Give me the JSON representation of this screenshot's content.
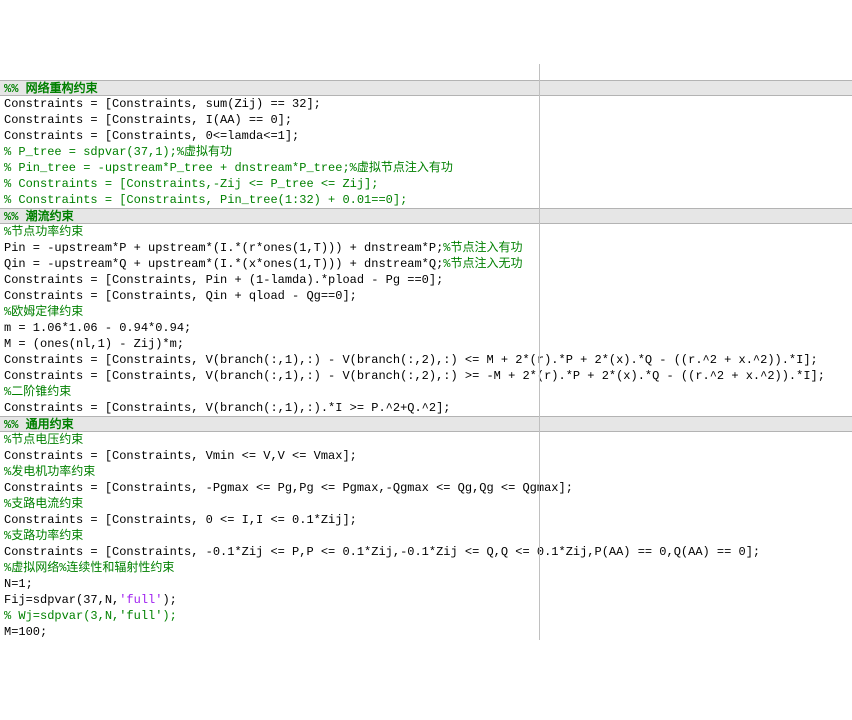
{
  "guides": [
    539
  ],
  "lines": [
    {
      "type": "section",
      "tokens": [
        {
          "cls": "c-section",
          "t": "%% 网络重构约束"
        }
      ]
    },
    {
      "type": "code",
      "tokens": [
        {
          "cls": "c-code",
          "t": "Constraints = [Constraints, sum(Zij) == 32];"
        }
      ]
    },
    {
      "type": "code",
      "tokens": [
        {
          "cls": "c-code",
          "t": "Constraints = [Constraints, I(AA) == 0];"
        }
      ]
    },
    {
      "type": "code",
      "tokens": [
        {
          "cls": "c-code",
          "t": "Constraints = [Constraints, 0<=lamda<=1];"
        }
      ]
    },
    {
      "type": "code",
      "tokens": [
        {
          "cls": "c-comment",
          "t": "% P_tree = sdpvar(37,1);%虚拟有功"
        }
      ]
    },
    {
      "type": "code",
      "tokens": [
        {
          "cls": "c-comment",
          "t": "% Pin_tree = -upstream*P_tree + dnstream*P_tree;%虚拟节点注入有功"
        }
      ]
    },
    {
      "type": "code",
      "tokens": [
        {
          "cls": "c-comment",
          "t": "% Constraints = [Constraints,-Zij <= P_tree <= Zij];"
        }
      ]
    },
    {
      "type": "code",
      "tokens": [
        {
          "cls": "c-comment",
          "t": "% Constraints = [Constraints, Pin_tree(1:32) + 0.01==0];"
        }
      ]
    },
    {
      "type": "section",
      "tokens": [
        {
          "cls": "c-section",
          "t": "%% 潮流约束"
        }
      ]
    },
    {
      "type": "code",
      "tokens": [
        {
          "cls": "c-comment",
          "t": "%节点功率约束"
        }
      ]
    },
    {
      "type": "code",
      "tokens": [
        {
          "cls": "c-code",
          "t": "Pin = -upstream*P + upstream*(I.*(r*ones(1,T))) + dnstream*P;"
        },
        {
          "cls": "c-comment",
          "t": "%节点注入有功"
        }
      ]
    },
    {
      "type": "code",
      "tokens": [
        {
          "cls": "c-code",
          "t": "Qin = -upstream*Q + upstream*(I.*(x*ones(1,T))) + dnstream*Q;"
        },
        {
          "cls": "c-comment",
          "t": "%节点注入无功"
        }
      ]
    },
    {
      "type": "code",
      "tokens": [
        {
          "cls": "c-code",
          "t": "Constraints = [Constraints, Pin + (1-lamda).*pload - Pg ==0];"
        }
      ]
    },
    {
      "type": "code",
      "tokens": [
        {
          "cls": "c-code",
          "t": "Constraints = [Constraints, Qin + qload - Qg==0];"
        }
      ]
    },
    {
      "type": "code",
      "tokens": [
        {
          "cls": "c-comment",
          "t": "%欧姆定律约束"
        }
      ]
    },
    {
      "type": "code",
      "tokens": [
        {
          "cls": "c-code",
          "t": "m = 1.06*1.06 - 0.94*0.94;"
        }
      ]
    },
    {
      "type": "code",
      "tokens": [
        {
          "cls": "c-code",
          "t": "M = (ones(nl,1) - Zij)*m;"
        }
      ]
    },
    {
      "type": "code",
      "tokens": [
        {
          "cls": "c-code",
          "t": "Constraints = [Constraints, V(branch(:,1),:) - V(branch(:,2),:) <= M + 2*(r).*P + 2*(x).*Q - ((r.^2 + x.^2)).*I];"
        }
      ]
    },
    {
      "type": "code",
      "tokens": [
        {
          "cls": "c-code",
          "t": "Constraints = [Constraints, V(branch(:,1),:) - V(branch(:,2),:) >= -M + 2*(r).*P + 2*(x).*Q - ((r.^2 + x.^2)).*I];"
        }
      ]
    },
    {
      "type": "code",
      "tokens": [
        {
          "cls": "c-comment",
          "t": "%二阶锥约束"
        }
      ]
    },
    {
      "type": "code",
      "tokens": [
        {
          "cls": "c-code",
          "t": "Constraints = [Constraints, V(branch(:,1),:).*I >= P.^2+Q.^2];"
        }
      ]
    },
    {
      "type": "section",
      "tokens": [
        {
          "cls": "c-section",
          "t": "%% 通用约束"
        }
      ]
    },
    {
      "type": "code",
      "tokens": [
        {
          "cls": "c-comment",
          "t": "%节点电压约束"
        }
      ]
    },
    {
      "type": "code",
      "tokens": [
        {
          "cls": "c-code",
          "t": "Constraints = [Constraints, Vmin <= V,V <= Vmax];"
        }
      ]
    },
    {
      "type": "code",
      "tokens": [
        {
          "cls": "c-comment",
          "t": "%发电机功率约束"
        }
      ]
    },
    {
      "type": "code",
      "tokens": [
        {
          "cls": "c-code",
          "t": "Constraints = [Constraints, -Pgmax <= Pg,Pg <= Pgmax,-Qgmax <= Qg,Qg <= Qgmax];"
        }
      ]
    },
    {
      "type": "code",
      "tokens": [
        {
          "cls": "c-comment",
          "t": "%支路电流约束"
        }
      ]
    },
    {
      "type": "code",
      "tokens": [
        {
          "cls": "c-code",
          "t": "Constraints = [Constraints, 0 <= I,I <= 0.1*Zij];"
        }
      ]
    },
    {
      "type": "code",
      "tokens": [
        {
          "cls": "c-comment",
          "t": "%支路功率约束"
        }
      ]
    },
    {
      "type": "code",
      "tokens": [
        {
          "cls": "c-code",
          "t": "Constraints = [Constraints, -0.1*Zij <= P,P <= 0.1*Zij,-0.1*Zij <= Q,Q <= 0.1*Zij,P(AA) == 0,Q(AA) == 0];"
        }
      ]
    },
    {
      "type": "code",
      "tokens": [
        {
          "cls": "c-comment",
          "t": "%虚拟网络%连续性和辐射性约束"
        }
      ]
    },
    {
      "type": "code",
      "tokens": [
        {
          "cls": "c-code",
          "t": "N=1;"
        }
      ]
    },
    {
      "type": "code",
      "tokens": [
        {
          "cls": "c-code",
          "t": "Fij=sdpvar(37,N,"
        },
        {
          "cls": "c-string",
          "t": "'full'"
        },
        {
          "cls": "c-code",
          "t": ");"
        }
      ]
    },
    {
      "type": "code",
      "tokens": [
        {
          "cls": "c-comment",
          "t": "% Wj=sdpvar(3,N,'full');"
        }
      ]
    },
    {
      "type": "code",
      "tokens": [
        {
          "cls": "c-code",
          "t": "M=100;"
        }
      ]
    }
  ]
}
